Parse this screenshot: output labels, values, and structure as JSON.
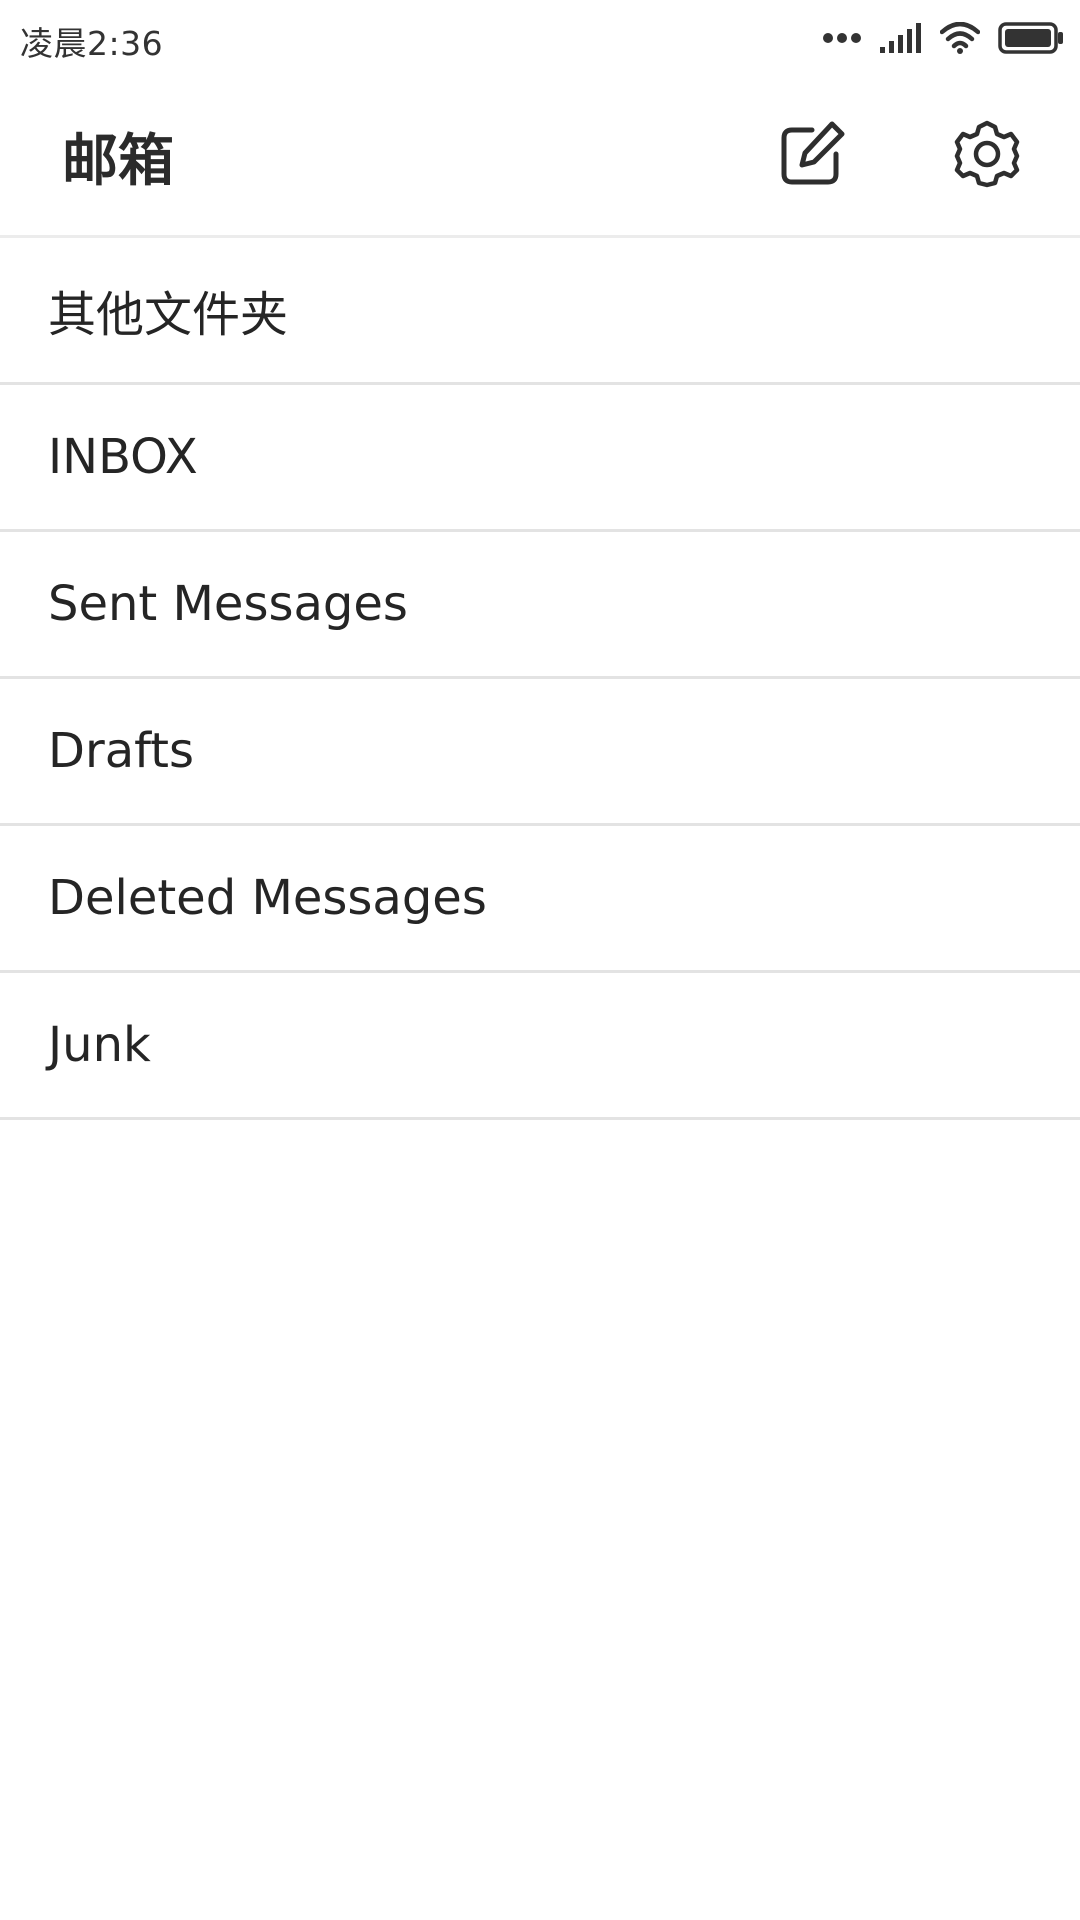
{
  "status_bar": {
    "time": "凌晨2:36",
    "icons": [
      "more-dots-icon",
      "signal-icon",
      "wifi-icon",
      "battery-icon"
    ]
  },
  "header": {
    "title": "邮箱",
    "compose_icon": "compose-icon",
    "settings_icon": "gear-icon"
  },
  "folders": [
    {
      "label": "其他文件夹"
    },
    {
      "label": "INBOX"
    },
    {
      "label": "Sent Messages"
    },
    {
      "label": "Drafts"
    },
    {
      "label": "Deleted Messages"
    },
    {
      "label": "Junk"
    }
  ],
  "colors": {
    "background": "#ffffff",
    "text": "#222222",
    "divider": "#e3e3e3"
  }
}
